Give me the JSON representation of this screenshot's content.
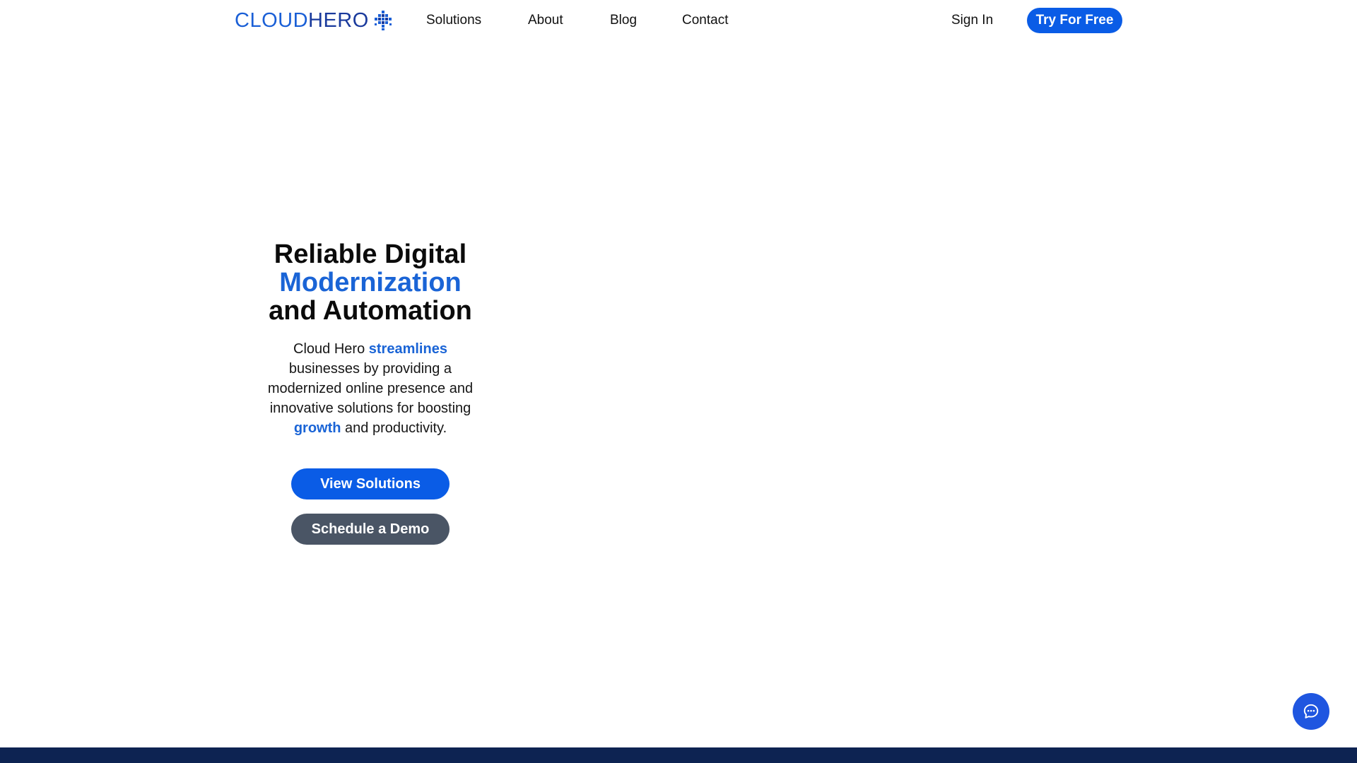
{
  "brand": {
    "logo_part1": "CLOUD",
    "logo_part2": "HERO",
    "logo_mark_icon": "diamond-grid-icon",
    "primary_color": "#0a5ce6",
    "accent_text_color": "#1a64d6",
    "secondary_button_color": "#4a5565",
    "footer_color": "#0d2352"
  },
  "nav": {
    "links": [
      "Solutions",
      "About",
      "Blog",
      "Contact"
    ],
    "signin": "Sign In",
    "cta": "Try For Free"
  },
  "hero": {
    "title_line1": "Reliable Digital",
    "title_line2": "Modernization",
    "title_line3": "and Automation",
    "desc_prefix": "Cloud Hero ",
    "desc_highlight1": "streamlines",
    "desc_middle": " businesses by providing a modernized online presence and innovative solutions for boosting ",
    "desc_highlight2": "growth",
    "desc_suffix": " and productivity.",
    "primary_button": "View Solutions",
    "secondary_button": "Schedule a Demo"
  },
  "chat": {
    "icon": "chat-bubble-icon"
  }
}
